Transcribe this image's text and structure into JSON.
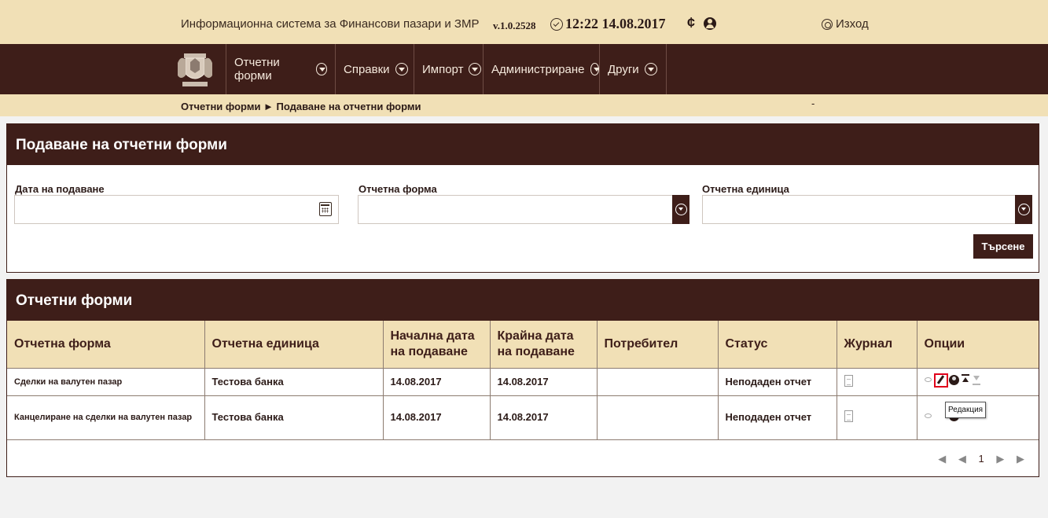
{
  "app": {
    "title": "Информационна система за Финансови пазари и ЗМР",
    "version": "v.1.0.2528",
    "datetime": "12:22 14.08.2017",
    "logout_label": "Изход"
  },
  "nav": {
    "items": [
      {
        "label": "Отчетни форми"
      },
      {
        "label": "Справки"
      },
      {
        "label": "Импорт"
      },
      {
        "label": "Администриране"
      },
      {
        "label": "Други"
      }
    ]
  },
  "breadcrumb": {
    "text": "Отчетни форми ► Подаване на отчетни форми",
    "dash": "-"
  },
  "search": {
    "title": "Подаване на отчетни форми",
    "date_label": "Дата на подаване",
    "date_value": "",
    "form_label": "Отчетна форма",
    "form_value": "",
    "unit_label": "Отчетна единица",
    "unit_value": "",
    "search_button": "Търсене"
  },
  "forms": {
    "title": "Отчетни форми",
    "columns": [
      "Отчетна форма",
      "Отчетна единица",
      "Начална дата на подаване",
      "Крайна дата на подаване",
      "Потребител",
      "Статус",
      "Журнал",
      "Опции"
    ],
    "rows": [
      {
        "form": "Сделки на валутен пазар",
        "unit": "Тестова банка",
        "start": "14.08.2017",
        "end": "14.08.2017",
        "user": "",
        "status": "Неподаден отчет"
      },
      {
        "form": "Канцелиране на сделки на валутен пазар",
        "unit": "Тестова банка",
        "start": "14.08.2017",
        "end": "14.08.2017",
        "user": "",
        "status": "Неподаден отчет"
      }
    ],
    "tooltip": "Редакция",
    "pager": {
      "first": "◀",
      "prev": "◀",
      "current": "1",
      "next": "▶",
      "last": "▶"
    }
  },
  "colors": {
    "brand_dark": "#3e1e19",
    "brand_light": "#f1e0b6",
    "highlight": "#e0001b"
  }
}
